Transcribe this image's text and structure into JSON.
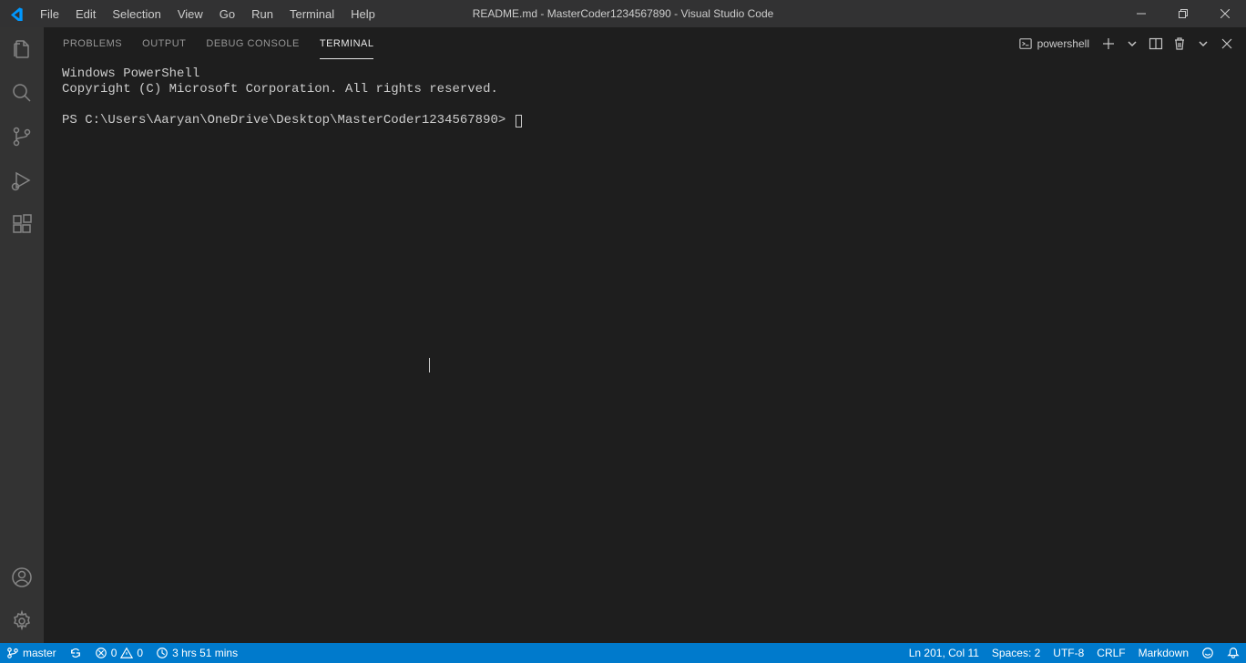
{
  "titlebar": {
    "menus": [
      "File",
      "Edit",
      "Selection",
      "View",
      "Go",
      "Run",
      "Terminal",
      "Help"
    ],
    "title": "README.md - MasterCoder1234567890 - Visual Studio Code"
  },
  "panel": {
    "tabs": [
      "PROBLEMS",
      "OUTPUT",
      "DEBUG CONSOLE",
      "TERMINAL"
    ],
    "active_tab_index": 3,
    "shell_label": "powershell"
  },
  "terminal": {
    "line1": "Windows PowerShell",
    "line2": "Copyright (C) Microsoft Corporation. All rights reserved.",
    "prompt": "PS C:\\Users\\Aaryan\\OneDrive\\Desktop\\MasterCoder1234567890>"
  },
  "statusbar": {
    "branch": "master",
    "errors": "0",
    "warnings": "0",
    "time": "3 hrs 51 mins",
    "line_col": "Ln 201, Col 11",
    "spaces": "Spaces: 2",
    "encoding": "UTF-8",
    "eol": "CRLF",
    "language": "Markdown"
  }
}
